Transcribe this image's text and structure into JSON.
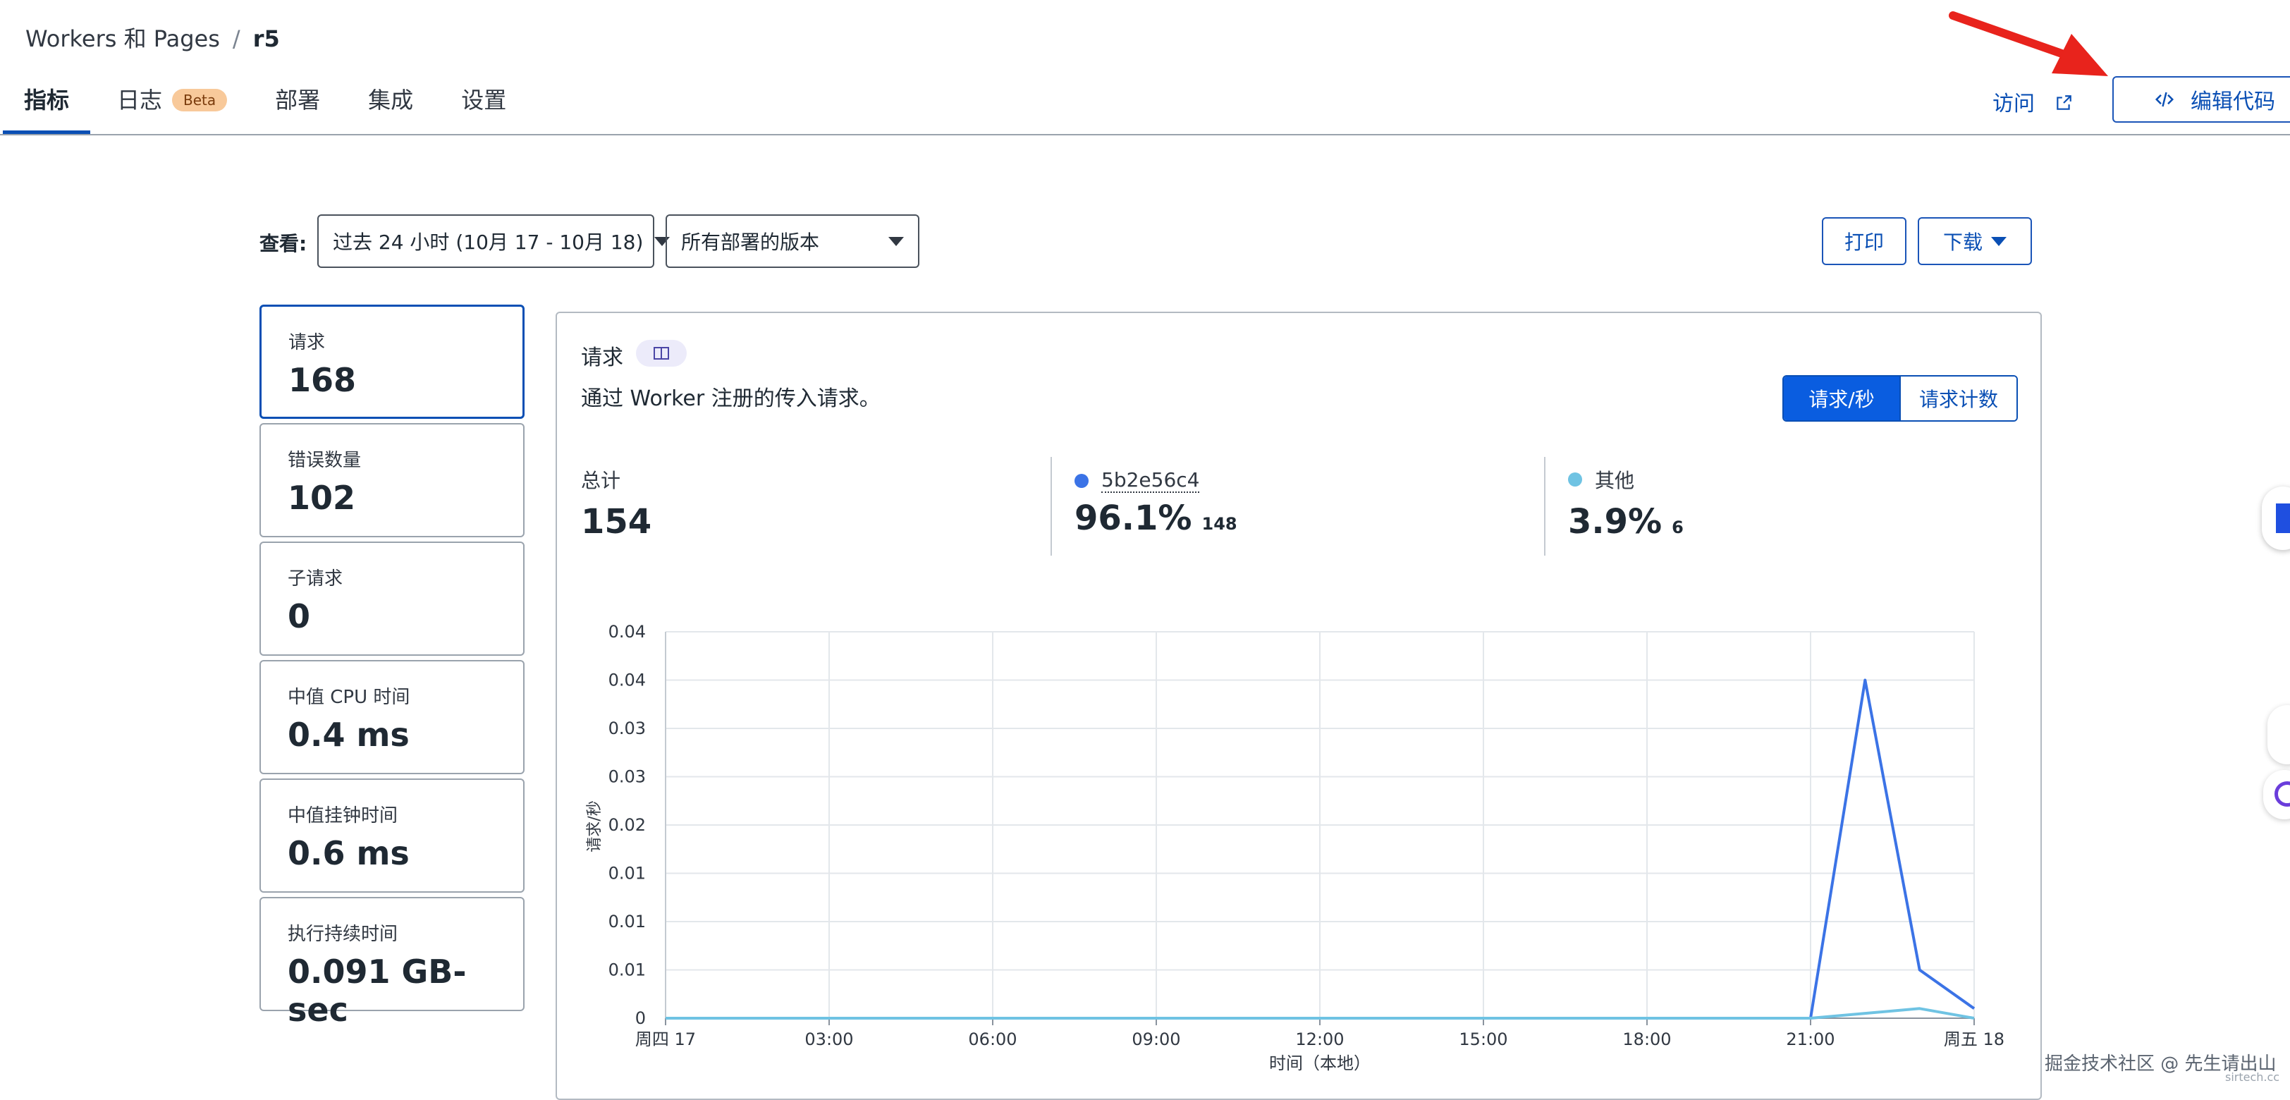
{
  "breadcrumb": {
    "root": "Workers 和 Pages",
    "separator": "/",
    "current": "r5"
  },
  "tabs": [
    {
      "label": "指标",
      "active": true
    },
    {
      "label": "日志",
      "badge": "Beta"
    },
    {
      "label": "部署"
    },
    {
      "label": "集成"
    },
    {
      "label": "设置"
    }
  ],
  "header_actions": {
    "visit": "访问",
    "edit_code": "编辑代码"
  },
  "toolbar": {
    "view_label": "查看:",
    "time_range": "过去 24 小时 (10月 17 - 10月 18)",
    "version_filter": "所有部署的版本",
    "print": "打印",
    "download": "下载"
  },
  "metrics": [
    {
      "label": "请求",
      "value": "168",
      "active": true
    },
    {
      "label": "错误数量",
      "value": "102"
    },
    {
      "label": "子请求",
      "value": "0"
    },
    {
      "label": "中值 CPU 时间",
      "value": "0.4 ms"
    },
    {
      "label": "中值挂钟时间",
      "value": "0.6 ms"
    },
    {
      "label": "执行持续时间",
      "value": "0.091 GB-sec"
    }
  ],
  "panel": {
    "title": "请求",
    "description": "通过 Worker 注册的传入请求。",
    "toggle": {
      "rate": "请求/秒",
      "count": "请求计数"
    },
    "stats": [
      {
        "label": "总计",
        "value": "154"
      },
      {
        "label": "5b2e56c4",
        "value": "96.1%",
        "sub": "148",
        "color": "#3b73e6"
      },
      {
        "label": "其他",
        "value": "3.9%",
        "sub": "6",
        "color": "#6fc3e3"
      }
    ]
  },
  "chart_data": {
    "type": "line",
    "xlabel": "时间（本地）",
    "ylabel": "请求/秒",
    "x_ticks": [
      "周四 17",
      "03:00",
      "06:00",
      "09:00",
      "12:00",
      "15:00",
      "18:00",
      "21:00",
      "周五 18"
    ],
    "y_ticks": [
      "0",
      "0.01",
      "0.01",
      "0.01",
      "0.02",
      "0.03",
      "0.03",
      "0.04",
      "0.04"
    ],
    "ylim": [
      0,
      0.04
    ],
    "grid": true,
    "series": [
      {
        "name": "5b2e56c4",
        "color": "#3b73e6",
        "x": [
          "周四 17",
          "21:00",
          "22:00",
          "23:00",
          "周五 18"
        ],
        "values": [
          0,
          0,
          0.035,
          0.005,
          0.001
        ]
      },
      {
        "name": "其他",
        "color": "#6fc3e3",
        "x": [
          "周四 17",
          "21:00",
          "22:00",
          "23:00",
          "周五 18"
        ],
        "values": [
          0,
          0,
          0.0005,
          0.001,
          0
        ]
      }
    ]
  },
  "watermark": {
    "text": "掘金技术社区 @ 先生请出山",
    "sub": "sirtech.cc"
  },
  "colors": {
    "accent": "#0a4fb4",
    "primary_button": "#0a5de0",
    "annotation_arrow": "#e8231c"
  }
}
